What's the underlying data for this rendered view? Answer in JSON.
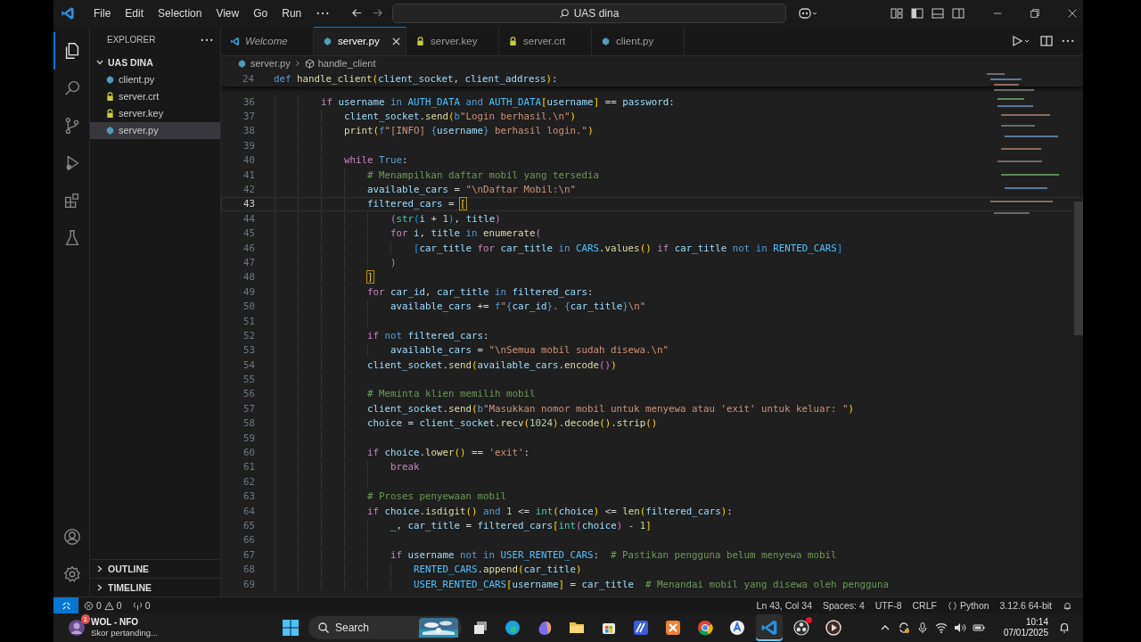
{
  "title_bar": {
    "menus": [
      "File",
      "Edit",
      "Selection",
      "View",
      "Go",
      "Run"
    ],
    "command_center": "UAS dina"
  },
  "activity_bar": [
    {
      "kind": "files",
      "selected": true
    },
    {
      "kind": "search",
      "selected": false
    },
    {
      "kind": "source-control",
      "selected": false
    },
    {
      "kind": "run",
      "selected": false
    },
    {
      "kind": "extensions",
      "selected": false
    },
    {
      "kind": "testing",
      "selected": false
    }
  ],
  "activity_bar_bottom": [
    {
      "kind": "account"
    },
    {
      "kind": "settings"
    }
  ],
  "sidebar": {
    "title": "EXPLORER",
    "tree": [
      {
        "label": "UAS DINA",
        "expanded": true,
        "selected": false,
        "children": [
          {
            "label": "client.py",
            "kind": "python",
            "selected": false
          },
          {
            "label": "server.crt",
            "kind": "lock",
            "selected": false
          },
          {
            "label": "server.key",
            "kind": "lock",
            "selected": false
          },
          {
            "label": "server.py",
            "kind": "python",
            "selected": true
          }
        ]
      }
    ],
    "sections": [
      {
        "label": "OUTLINE",
        "expanded": false
      },
      {
        "label": "TIMELINE",
        "expanded": false
      }
    ]
  },
  "tabs": [
    {
      "label": "Welcome",
      "kind": "welcome",
      "preview": true,
      "selected": false
    },
    {
      "label": "server.py",
      "kind": "python",
      "preview": false,
      "selected": true
    },
    {
      "label": "server.key",
      "kind": "lock",
      "preview": false,
      "selected": false
    },
    {
      "label": "server.crt",
      "kind": "lock",
      "preview": false,
      "selected": false
    },
    {
      "label": "client.py",
      "kind": "python",
      "preview": false,
      "selected": false
    }
  ],
  "breadcrumb": [
    {
      "label": "server.py",
      "kind": "python"
    },
    {
      "label": "handle_client",
      "kind": "method"
    }
  ],
  "sticky_line": {
    "number": "24",
    "tokens": [
      {
        "kind": "kw",
        "text": "def "
      },
      {
        "kind": "fn",
        "text": "handle_client"
      },
      {
        "kind": "b1",
        "text": "("
      },
      {
        "kind": "var",
        "text": "client_socket"
      },
      {
        "kind": "p",
        "text": ", "
      },
      {
        "kind": "var",
        "text": "client_address"
      },
      {
        "kind": "b1",
        "text": ")"
      },
      {
        "kind": "p",
        "text": ":"
      }
    ]
  },
  "code_lines": [
    {
      "number": "36",
      "current": false,
      "tokens": [
        {
          "kind": "ctl",
          "text": "        if "
        },
        {
          "kind": "var",
          "text": "username"
        },
        {
          "kind": "kw",
          "text": " in "
        },
        {
          "kind": "const",
          "text": "AUTH_DATA"
        },
        {
          "kind": "kw",
          "text": " and "
        },
        {
          "kind": "const",
          "text": "AUTH_DATA"
        },
        {
          "kind": "b1",
          "text": "["
        },
        {
          "kind": "var",
          "text": "username"
        },
        {
          "kind": "b1",
          "text": "]"
        },
        {
          "kind": "p",
          "text": " == "
        },
        {
          "kind": "var",
          "text": "password"
        },
        {
          "kind": "p",
          "text": ":"
        }
      ]
    },
    {
      "number": "37",
      "current": false,
      "tokens": [
        {
          "kind": "var",
          "text": "            client_socket"
        },
        {
          "kind": "p",
          "text": "."
        },
        {
          "kind": "fn",
          "text": "send"
        },
        {
          "kind": "b1",
          "text": "("
        },
        {
          "kind": "kw",
          "text": "b"
        },
        {
          "kind": "str",
          "text": "\"Login berhasil.\\n\""
        },
        {
          "kind": "b1",
          "text": ")"
        }
      ]
    },
    {
      "number": "38",
      "current": false,
      "tokens": [
        {
          "kind": "fn",
          "text": "            print"
        },
        {
          "kind": "b1",
          "text": "("
        },
        {
          "kind": "kw",
          "text": "f"
        },
        {
          "kind": "str",
          "text": "\"[INFO] "
        },
        {
          "kind": "kw",
          "text": "{"
        },
        {
          "kind": "var",
          "text": "username"
        },
        {
          "kind": "kw",
          "text": "}"
        },
        {
          "kind": "str",
          "text": " berhasil login.\""
        },
        {
          "kind": "b1",
          "text": ")"
        }
      ]
    },
    {
      "number": "39",
      "current": false
    },
    {
      "number": "40",
      "current": false,
      "tokens": [
        {
          "kind": "ctl",
          "text": "            while "
        },
        {
          "kind": "kw",
          "text": "True"
        },
        {
          "kind": "p",
          "text": ":"
        }
      ]
    },
    {
      "number": "41",
      "current": false,
      "tokens": [
        {
          "kind": "cmt",
          "text": "                # Menampilkan daftar mobil yang tersedia"
        }
      ]
    },
    {
      "number": "42",
      "current": false,
      "tokens": [
        {
          "kind": "var",
          "text": "                available_cars"
        },
        {
          "kind": "p",
          "text": " = "
        },
        {
          "kind": "str",
          "text": "\"\\nDaftar Mobil:\\n\""
        }
      ]
    },
    {
      "number": "43",
      "current": true,
      "tokens": [
        {
          "kind": "var",
          "text": "                filtered_cars"
        },
        {
          "kind": "p",
          "text": " = "
        },
        {
          "kind": "match",
          "text": "["
        }
      ]
    },
    {
      "number": "44",
      "current": false,
      "tokens": [
        {
          "kind": "b2",
          "text": "                    ("
        },
        {
          "kind": "cls",
          "text": "str"
        },
        {
          "kind": "b3",
          "text": "("
        },
        {
          "kind": "var",
          "text": "i"
        },
        {
          "kind": "p",
          "text": " + "
        },
        {
          "kind": "num",
          "text": "1"
        },
        {
          "kind": "b3",
          "text": ")"
        },
        {
          "kind": "p",
          "text": ", "
        },
        {
          "kind": "var",
          "text": "title"
        },
        {
          "kind": "b2",
          "text": ")"
        }
      ]
    },
    {
      "number": "45",
      "current": false,
      "tokens": [
        {
          "kind": "ctl",
          "text": "                    for "
        },
        {
          "kind": "var",
          "text": "i"
        },
        {
          "kind": "p",
          "text": ", "
        },
        {
          "kind": "var",
          "text": "title"
        },
        {
          "kind": "kw",
          "text": " in "
        },
        {
          "kind": "fn",
          "text": "enumerate"
        },
        {
          "kind": "b2",
          "text": "("
        }
      ]
    },
    {
      "number": "46",
      "current": false,
      "tokens": [
        {
          "kind": "b3",
          "text": "                        ["
        },
        {
          "kind": "var",
          "text": "car_title "
        },
        {
          "kind": "ctl",
          "text": "for "
        },
        {
          "kind": "var",
          "text": "car_title"
        },
        {
          "kind": "kw",
          "text": " in "
        },
        {
          "kind": "const",
          "text": "CARS"
        },
        {
          "kind": "p",
          "text": "."
        },
        {
          "kind": "fn",
          "text": "values"
        },
        {
          "kind": "b1",
          "text": "() "
        },
        {
          "kind": "ctl",
          "text": "if "
        },
        {
          "kind": "var",
          "text": "car_title"
        },
        {
          "kind": "kw",
          "text": " not in "
        },
        {
          "kind": "const",
          "text": "RENTED_CARS"
        },
        {
          "kind": "b3",
          "text": "]"
        }
      ]
    },
    {
      "number": "47",
      "current": false,
      "tokens": [
        {
          "kind": "b2",
          "text": "                    )"
        }
      ]
    },
    {
      "number": "48",
      "current": false,
      "tokens": [
        {
          "kind": "match",
          "text": "                ]"
        }
      ]
    },
    {
      "number": "49",
      "current": false,
      "tokens": [
        {
          "kind": "ctl",
          "text": "                for "
        },
        {
          "kind": "var",
          "text": "car_id"
        },
        {
          "kind": "p",
          "text": ", "
        },
        {
          "kind": "var",
          "text": "car_title"
        },
        {
          "kind": "kw",
          "text": " in "
        },
        {
          "kind": "var",
          "text": "filtered_cars"
        },
        {
          "kind": "p",
          "text": ":"
        }
      ]
    },
    {
      "number": "50",
      "current": false,
      "tokens": [
        {
          "kind": "var",
          "text": "                    available_cars"
        },
        {
          "kind": "p",
          "text": " += "
        },
        {
          "kind": "kw",
          "text": "f"
        },
        {
          "kind": "str",
          "text": "\""
        },
        {
          "kind": "kw",
          "text": "{"
        },
        {
          "kind": "var",
          "text": "car_id"
        },
        {
          "kind": "kw",
          "text": "}"
        },
        {
          "kind": "str",
          "text": ". "
        },
        {
          "kind": "kw",
          "text": "{"
        },
        {
          "kind": "var",
          "text": "car_title"
        },
        {
          "kind": "kw",
          "text": "}"
        },
        {
          "kind": "str",
          "text": "\\n\""
        }
      ]
    },
    {
      "number": "51",
      "current": false
    },
    {
      "number": "52",
      "current": false,
      "tokens": [
        {
          "kind": "ctl",
          "text": "                if"
        },
        {
          "kind": "kw",
          "text": " not "
        },
        {
          "kind": "var",
          "text": "filtered_cars"
        },
        {
          "kind": "p",
          "text": ":"
        }
      ]
    },
    {
      "number": "53",
      "current": false,
      "tokens": [
        {
          "kind": "var",
          "text": "                    available_cars"
        },
        {
          "kind": "p",
          "text": " = "
        },
        {
          "kind": "str",
          "text": "\"\\nSemua mobil sudah disewa.\\n\""
        }
      ]
    },
    {
      "number": "54",
      "current": false,
      "tokens": [
        {
          "kind": "var",
          "text": "                client_socket"
        },
        {
          "kind": "p",
          "text": "."
        },
        {
          "kind": "fn",
          "text": "send"
        },
        {
          "kind": "b1",
          "text": "("
        },
        {
          "kind": "var",
          "text": "available_cars"
        },
        {
          "kind": "p",
          "text": "."
        },
        {
          "kind": "fn",
          "text": "encode"
        },
        {
          "kind": "b2",
          "text": "()"
        },
        {
          "kind": "b1",
          "text": ")"
        }
      ]
    },
    {
      "number": "55",
      "current": false
    },
    {
      "number": "56",
      "current": false,
      "tokens": [
        {
          "kind": "cmt",
          "text": "                # Meminta klien memilih mobil"
        }
      ]
    },
    {
      "number": "57",
      "current": false,
      "tokens": [
        {
          "kind": "var",
          "text": "                client_socket"
        },
        {
          "kind": "p",
          "text": "."
        },
        {
          "kind": "fn",
          "text": "send"
        },
        {
          "kind": "b1",
          "text": "("
        },
        {
          "kind": "kw",
          "text": "b"
        },
        {
          "kind": "str",
          "text": "\"Masukkan nomor mobil untuk menyewa atau 'exit' untuk keluar: \""
        },
        {
          "kind": "b1",
          "text": ")"
        }
      ]
    },
    {
      "number": "58",
      "current": false,
      "tokens": [
        {
          "kind": "var",
          "text": "                choice"
        },
        {
          "kind": "p",
          "text": " = "
        },
        {
          "kind": "var",
          "text": "client_socket"
        },
        {
          "kind": "p",
          "text": "."
        },
        {
          "kind": "fn",
          "text": "recv"
        },
        {
          "kind": "b1",
          "text": "("
        },
        {
          "kind": "num",
          "text": "1024"
        },
        {
          "kind": "b1",
          "text": ")"
        },
        {
          "kind": "p",
          "text": "."
        },
        {
          "kind": "fn",
          "text": "decode"
        },
        {
          "kind": "b1",
          "text": "()"
        },
        {
          "kind": "p",
          "text": "."
        },
        {
          "kind": "fn",
          "text": "strip"
        },
        {
          "kind": "b1",
          "text": "()"
        }
      ]
    },
    {
      "number": "59",
      "current": false
    },
    {
      "number": "60",
      "current": false,
      "tokens": [
        {
          "kind": "ctl",
          "text": "                if "
        },
        {
          "kind": "var",
          "text": "choice"
        },
        {
          "kind": "p",
          "text": "."
        },
        {
          "kind": "fn",
          "text": "lower"
        },
        {
          "kind": "b1",
          "text": "()"
        },
        {
          "kind": "p",
          "text": " == "
        },
        {
          "kind": "str",
          "text": "'exit'"
        },
        {
          "kind": "p",
          "text": ":"
        }
      ]
    },
    {
      "number": "61",
      "current": false,
      "tokens": [
        {
          "kind": "ctl",
          "text": "                    break"
        }
      ]
    },
    {
      "number": "62",
      "current": false
    },
    {
      "number": "63",
      "current": false,
      "tokens": [
        {
          "kind": "cmt",
          "text": "                # Proses penyewaan mobil"
        }
      ]
    },
    {
      "number": "64",
      "current": false,
      "tokens": [
        {
          "kind": "ctl",
          "text": "                if "
        },
        {
          "kind": "var",
          "text": "choice"
        },
        {
          "kind": "p",
          "text": "."
        },
        {
          "kind": "fn",
          "text": "isdigit"
        },
        {
          "kind": "b1",
          "text": "()"
        },
        {
          "kind": "kw",
          "text": " and "
        },
        {
          "kind": "num",
          "text": "1"
        },
        {
          "kind": "p",
          "text": " <= "
        },
        {
          "kind": "cls",
          "text": "int"
        },
        {
          "kind": "b1",
          "text": "("
        },
        {
          "kind": "var",
          "text": "choice"
        },
        {
          "kind": "b1",
          "text": ")"
        },
        {
          "kind": "p",
          "text": " <= "
        },
        {
          "kind": "fn",
          "text": "len"
        },
        {
          "kind": "b1",
          "text": "("
        },
        {
          "kind": "var",
          "text": "filtered_cars"
        },
        {
          "kind": "b1",
          "text": ")"
        },
        {
          "kind": "p",
          "text": ":"
        }
      ]
    },
    {
      "number": "65",
      "current": false,
      "tokens": [
        {
          "kind": "var",
          "text": "                    _"
        },
        {
          "kind": "p",
          "text": ", "
        },
        {
          "kind": "var",
          "text": "car_title"
        },
        {
          "kind": "p",
          "text": " = "
        },
        {
          "kind": "var",
          "text": "filtered_cars"
        },
        {
          "kind": "b1",
          "text": "["
        },
        {
          "kind": "cls",
          "text": "int"
        },
        {
          "kind": "b2",
          "text": "("
        },
        {
          "kind": "var",
          "text": "choice"
        },
        {
          "kind": "b2",
          "text": ")"
        },
        {
          "kind": "p",
          "text": " - "
        },
        {
          "kind": "num",
          "text": "1"
        },
        {
          "kind": "b1",
          "text": "]"
        }
      ]
    },
    {
      "number": "66",
      "current": false
    },
    {
      "number": "67",
      "current": false,
      "tokens": [
        {
          "kind": "ctl",
          "text": "                    if "
        },
        {
          "kind": "var",
          "text": "username"
        },
        {
          "kind": "kw",
          "text": " not in "
        },
        {
          "kind": "const",
          "text": "USER_RENTED_CARS"
        },
        {
          "kind": "p",
          "text": ":  "
        },
        {
          "kind": "cmt",
          "text": "# Pastikan pengguna belum menyewa mobil"
        }
      ]
    },
    {
      "number": "68",
      "current": false,
      "tokens": [
        {
          "kind": "const",
          "text": "                        RENTED_CARS"
        },
        {
          "kind": "p",
          "text": "."
        },
        {
          "kind": "fn",
          "text": "append"
        },
        {
          "kind": "b1",
          "text": "("
        },
        {
          "kind": "var",
          "text": "car_title"
        },
        {
          "kind": "b1",
          "text": ")"
        }
      ]
    },
    {
      "number": "69",
      "current": false,
      "tokens": [
        {
          "kind": "const",
          "text": "                        USER_RENTED_CARS"
        },
        {
          "kind": "b1",
          "text": "["
        },
        {
          "kind": "var",
          "text": "username"
        },
        {
          "kind": "b1",
          "text": "]"
        },
        {
          "kind": "p",
          "text": " = "
        },
        {
          "kind": "var",
          "text": "car_title"
        },
        {
          "kind": "cmt",
          "text": "  # Menandai mobil yang disewa oleh pengguna"
        }
      ]
    }
  ],
  "status_bar": {
    "errors": "0",
    "warnings": "0",
    "ports": "0",
    "right": [
      {
        "kind": "text",
        "text": "Ln 43, Col 34"
      },
      {
        "kind": "text",
        "text": "Spaces: 4"
      },
      {
        "kind": "text",
        "text": "UTF-8"
      },
      {
        "kind": "text",
        "text": "CRLF"
      },
      {
        "kind": "language",
        "text": "Python"
      },
      {
        "kind": "text",
        "text": "3.12.6 64-bit"
      }
    ]
  },
  "taskbar": {
    "widget": {
      "title": "WOL - NFO",
      "subtitle": "Skor pertanding...",
      "badge": "1"
    },
    "search": {
      "placeholder": "Search"
    },
    "apps": [
      {
        "kind": "taskview",
        "selected": false,
        "notification": false
      },
      {
        "kind": "edge",
        "selected": false,
        "notification": false
      },
      {
        "kind": "copilot",
        "selected": false,
        "notification": false
      },
      {
        "kind": "folder",
        "selected": false,
        "notification": false
      },
      {
        "kind": "store",
        "selected": false,
        "notification": false
      },
      {
        "kind": "blue-app",
        "selected": false,
        "notification": false
      },
      {
        "kind": "orange-app",
        "selected": false,
        "notification": false
      },
      {
        "kind": "chrome",
        "selected": false,
        "notification": false
      },
      {
        "kind": "letter-app",
        "selected": false,
        "notification": false
      },
      {
        "kind": "vscode",
        "selected": true,
        "notification": false
      },
      {
        "kind": "obs",
        "selected": false,
        "notification": true
      },
      {
        "kind": "player",
        "selected": false,
        "notification": false
      }
    ],
    "time": "10:14",
    "date": "07/01/2025"
  }
}
